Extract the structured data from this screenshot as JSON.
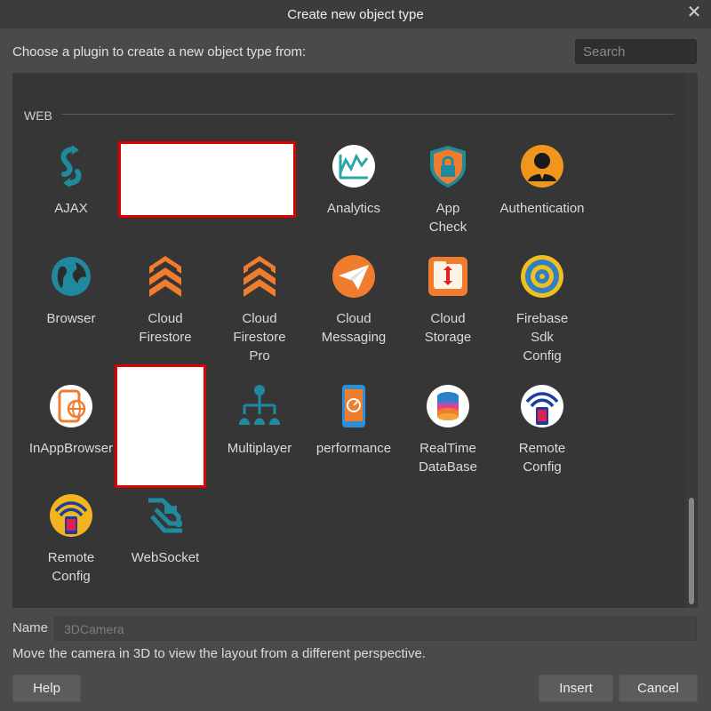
{
  "window": {
    "title": "Create new object type",
    "close_glyph": "✕"
  },
  "prompt": "Choose a plugin to create a new object type from:",
  "search": {
    "placeholder": "Search",
    "value": ""
  },
  "section": {
    "label": "WEB"
  },
  "items": [
    {
      "label": "AJAX",
      "icon": "ajax-icon"
    },
    {
      "label": "Analytics",
      "icon": "analytics-icon"
    },
    {
      "label": "App\nCheck",
      "icon": "app-check-icon"
    },
    {
      "label": "Authentication",
      "icon": "authentication-icon"
    },
    {
      "label": "Browser",
      "icon": "browser-icon"
    },
    {
      "label": "Cloud\nFirestore",
      "icon": "cloud-firestore-icon"
    },
    {
      "label": "Cloud\nFirestore\nPro",
      "icon": "cloud-firestore-pro-icon"
    },
    {
      "label": "Cloud\nMessaging",
      "icon": "cloud-messaging-icon"
    },
    {
      "label": "Cloud\nStorage",
      "icon": "cloud-storage-icon"
    },
    {
      "label": "Firebase\nSdk\nConfig",
      "icon": "firebase-sdk-config-icon"
    },
    {
      "label": "InAppBrowser",
      "icon": "in-app-browser-icon"
    },
    {
      "label": "Multiplayer",
      "icon": "multiplayer-icon"
    },
    {
      "label": "performance",
      "icon": "performance-icon"
    },
    {
      "label": "RealTime\nDataBase",
      "icon": "realtime-database-icon"
    },
    {
      "label": "Remote\nConfig",
      "icon": "remote-config-icon"
    },
    {
      "label": "Remote\nConfig",
      "icon": "remote-config-icon"
    },
    {
      "label": "WebSocket",
      "icon": "websocket-icon"
    }
  ],
  "name_field": {
    "label": "Name",
    "value": "3DCamera"
  },
  "description": "Move the camera in 3D to view the layout from a different perspective.",
  "buttons": {
    "help": "Help",
    "insert": "Insert",
    "cancel": "Cancel"
  },
  "colors": {
    "accent_orange": "#f07c2e",
    "teal": "#1f8a9e",
    "redaction_border": "#e00000"
  }
}
